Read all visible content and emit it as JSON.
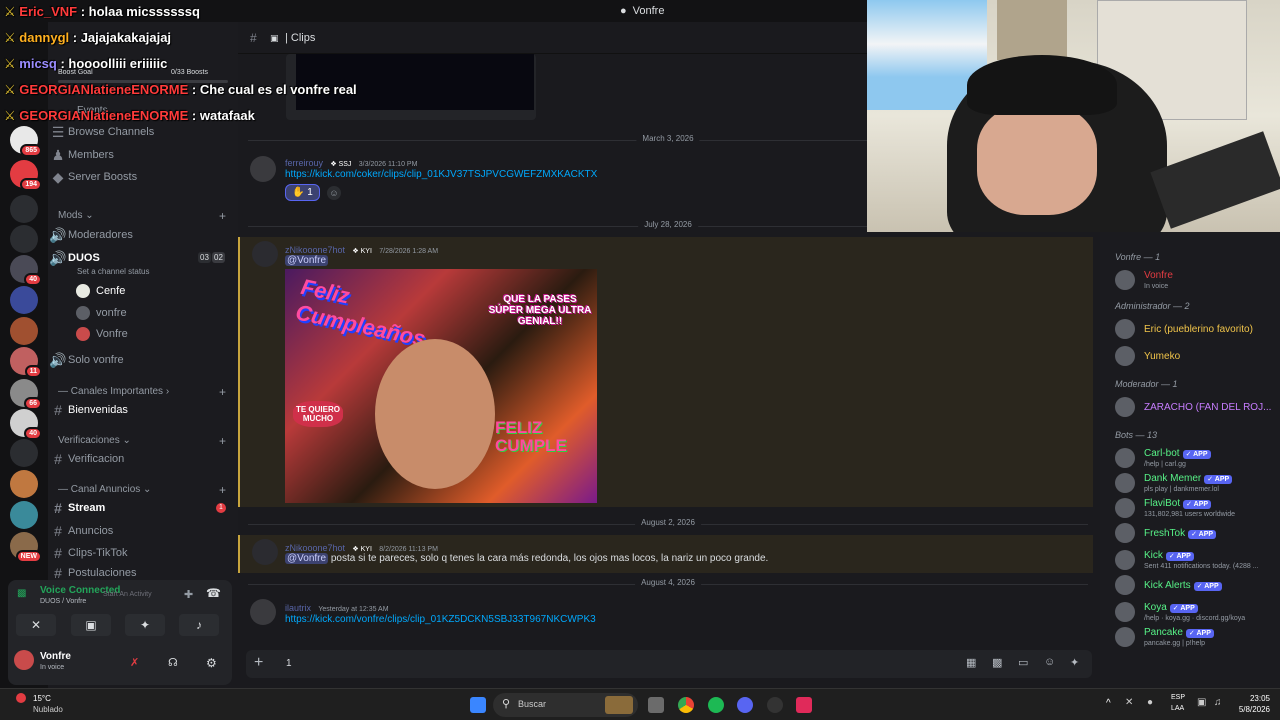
{
  "window": {
    "title": "Vonfre"
  },
  "overlay_chat": [
    {
      "user": "Eric_VNF",
      "text": "holaa micssssssq",
      "color": "#ff3b3b"
    },
    {
      "user": "dannygl",
      "text": "Jajajakakajajaj",
      "color": "#ffb020"
    },
    {
      "user": "micsq",
      "text": "hoooolliii eriiiiic",
      "color": "#9a8cff"
    },
    {
      "user": "GEORGIANlatieneENORME",
      "text": "Che cual es el vonfre real",
      "color": "#ff3b3b"
    },
    {
      "user": "GEORGIANlatieneENORME",
      "text": "watafaak",
      "color": "#ff3b3b"
    }
  ],
  "server_header": {
    "boost_goal": "Boost Goal",
    "boosts": "0/33 Boosts",
    "events": "Events"
  },
  "server_badges": [
    "865",
    "194",
    "",
    "",
    "40",
    "",
    "",
    "11",
    "66",
    "40",
    "",
    "",
    "",
    "NEW"
  ],
  "channels": {
    "browse": "Browse Channels",
    "members": "Members",
    "boosts": "Server Boosts",
    "cat_mods": "Mods",
    "moderadores": "Moderadores",
    "duos": "DUOS",
    "duos_status": "Set a channel status",
    "duos_count_a": "03",
    "duos_count_b": "02",
    "voice_users": [
      "Cenfe",
      "vonfre",
      "Vonfre"
    ],
    "solo_vonfre": "Solo vonfre",
    "cat_importantes": "Canales Importantes",
    "bienvenidas": "Bienvenidas",
    "cat_verificaciones": "Verificaciones",
    "verificacion": "Verificacion",
    "cat_anuncios": "Canal Anuncios",
    "stream": "Stream",
    "stream_badge": "1",
    "anuncios": "Anuncios",
    "clips_tiktok": "Clips-TikTok",
    "postulaciones": "Postulaciones"
  },
  "voice": {
    "status": "Voice Connected",
    "location": "DUOS / Vonfre",
    "user": "Vonfre",
    "user_status": "In voice",
    "tooltip": "Start An Activity"
  },
  "chat_header": {
    "channel": "Clips"
  },
  "messages": [
    {
      "date": "March 3, 2026",
      "user": "ferreirouy",
      "tag": "SSJ",
      "time": "3/3/2026 11:10 PM",
      "link": "https://kick.com/coker/clips/clip_01KJV37TSJPVCGWEFZMXKACKTX",
      "reaction_count": "1"
    },
    {
      "date": "July 28, 2026",
      "user": "zNikooone7hot",
      "tag": "KYI",
      "time": "7/28/2026 1:28 AM",
      "mention": "@Vonfre",
      "image_text_1": "Feliz Cumpleaños",
      "image_text_2": "QUE LA PASES SÚPER MEGA ULTRA GENIAL!!",
      "image_text_3": "TE QUIERO MUCHO",
      "image_text_4": "FELIZ CUMPLE"
    },
    {
      "date": "August 2, 2026",
      "user": "zNikooone7hot",
      "tag": "KYI",
      "time": "8/2/2026 11:13 PM",
      "mention": "@Vonfre",
      "text": "posta si te pareces, solo q tenes la cara más redonda, los ojos mas locos, la nariz un poco grande."
    },
    {
      "date": "August 4, 2026",
      "user": "ilautrix",
      "time": "Yesterday at 12:35 AM",
      "link": "https://kick.com/vonfre/clips/clip_01KZ5DCKN5SBJ33T967NKCWPK3"
    }
  ],
  "composer": {
    "value": "1"
  },
  "member_groups": [
    {
      "name": "Vonfre — 1",
      "members": [
        {
          "name": "Vonfre",
          "sub": "In voice",
          "color": "#e33c42"
        }
      ]
    },
    {
      "name": "Administrador — 2",
      "members": [
        {
          "name": "Eric (pueblerino favorito)",
          "color": "#f0c44a"
        },
        {
          "name": "Yumeko",
          "color": "#f0c44a"
        }
      ]
    },
    {
      "name": "Moderador — 1",
      "members": [
        {
          "name": "ZARACHO (FAN DEL ROJ...",
          "color": "#c77dff"
        }
      ]
    },
    {
      "name": "Bots — 13",
      "members": [
        {
          "name": "Carl-bot",
          "sub": "/help | carl.gg",
          "color": "#57f287",
          "app": "APP"
        },
        {
          "name": "Dank Memer",
          "sub": "pls play | dankmemer.lol",
          "color": "#57f287",
          "app": "APP"
        },
        {
          "name": "FlaviBot",
          "sub": "131,802,981 users worldwide",
          "color": "#57f287",
          "app": "APP"
        },
        {
          "name": "FreshTok",
          "color": "#57f287",
          "app": "APP"
        },
        {
          "name": "Kick",
          "sub": "Sent 411 notifications today. (4288 ...",
          "color": "#57f287",
          "app": "APP"
        },
        {
          "name": "Kick Alerts",
          "color": "#57f287",
          "app": "APP"
        },
        {
          "name": "Koya",
          "sub": "/help · koya.gg · discord.gg/koya",
          "color": "#57f287",
          "app": "APP"
        },
        {
          "name": "Pancake",
          "sub": "pancake.gg | p!help",
          "color": "#57f287",
          "app": "APP"
        }
      ]
    }
  ],
  "taskbar": {
    "weather_temp": "15°C",
    "weather_desc": "Nublado",
    "search": "Buscar",
    "lang_1": "ESP",
    "lang_2": "LAA",
    "time": "23:05",
    "date": "5/8/2026"
  }
}
